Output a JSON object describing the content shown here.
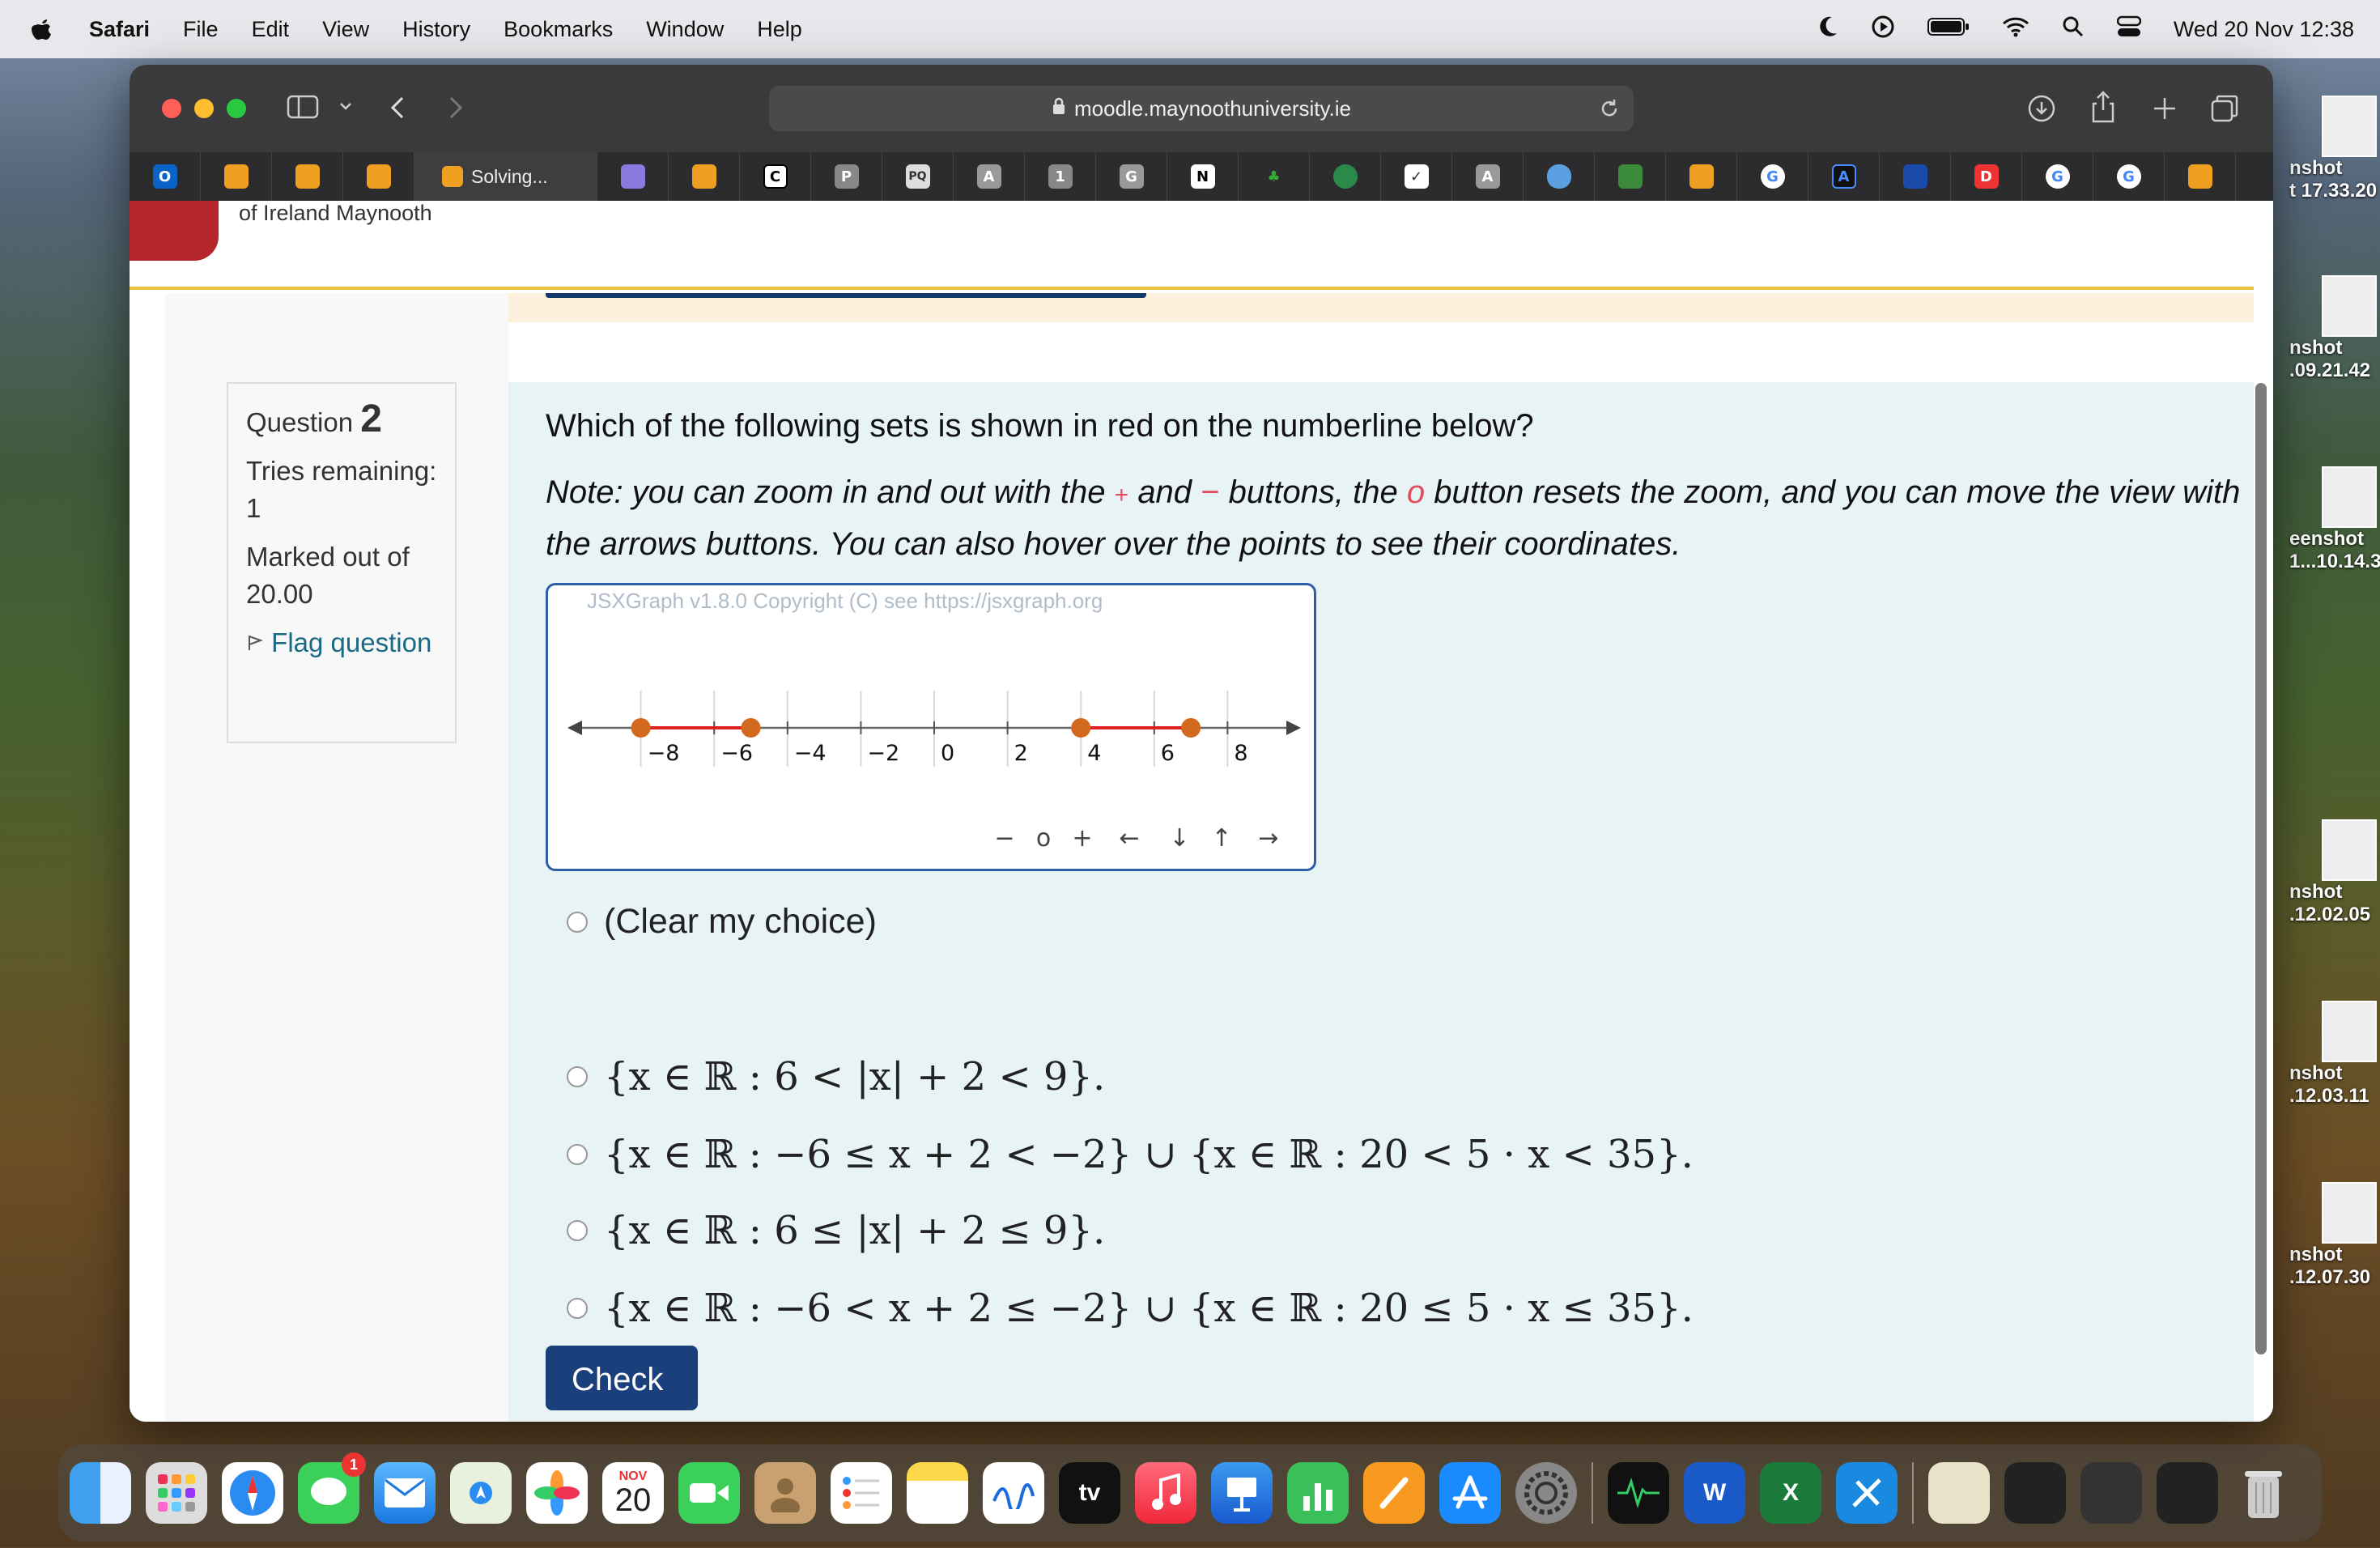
{
  "menubar": {
    "app": "Safari",
    "items": [
      "File",
      "Edit",
      "View",
      "History",
      "Bookmarks",
      "Window",
      "Help"
    ],
    "clock": "Wed 20 Nov  12:38"
  },
  "browser": {
    "url": "moodle.maynoothuniversity.ie",
    "active_tab": "Solving...",
    "tab_badges": [
      "O",
      "",
      "",
      "",
      "",
      "",
      "",
      "C",
      "P",
      "PQ",
      "A",
      "1",
      "G",
      "N",
      "",
      "",
      "",
      "",
      "A",
      "",
      "",
      "",
      "G",
      "A",
      "",
      "D",
      "G",
      "G",
      ""
    ]
  },
  "site": {
    "logo_text": "of Ireland Maynooth"
  },
  "question_info": {
    "label": "Question",
    "number": "2",
    "tries": "Tries remaining: 1",
    "marked": "Marked out of 20.00",
    "flag": "Flag question"
  },
  "question": {
    "text": "Which of the following sets is shown in red on the numberline below?",
    "note_a": "Note: you can zoom in and out with the",
    "plus": "+",
    "note_b": "and",
    "minus": "−",
    "note_c": "buttons, the",
    "reset": "o",
    "note_d": "button resets the zoom, and you can move the view with the arrows buttons. You can also hover over the points to see their coordinates."
  },
  "graph": {
    "copyright": "JSXGraph v1.8.0 Copyright (C) see https://jsxgraph.org",
    "ticks": [
      "−8",
      "−6",
      "−4",
      "−2",
      "0",
      "2",
      "4",
      "6",
      "8"
    ],
    "controls": [
      "−",
      "o",
      "+",
      "←",
      "↓",
      "↑",
      "→"
    ]
  },
  "chart_data": {
    "type": "line",
    "xlim": [
      -10,
      10
    ],
    "ticks": [
      -8,
      -6,
      -4,
      -2,
      0,
      2,
      4,
      6,
      8
    ],
    "series": [
      {
        "x": [
          -8,
          -5
        ],
        "y": [
          0,
          0
        ]
      },
      {
        "x": [
          4,
          7
        ],
        "y": [
          0,
          0
        ]
      }
    ],
    "points": [
      -8,
      -5,
      4,
      7
    ],
    "colors": {
      "segment": "#e02020",
      "point": "#d2691e"
    }
  },
  "options": {
    "clear": "(Clear my choice)",
    "choices": [
      "{x ∈ ℝ : 6 < |x| + 2 < 9}.",
      "{x ∈ ℝ : −6 ≤ x + 2 < −2} ∪ {x ∈ ℝ : 20 < 5 · x < 35}.",
      "{x ∈ ℝ : 6 ≤ |x| + 2 ≤ 9}.",
      "{x ∈ ℝ : −6 < x + 2 ≤ −2} ∪ {x ∈ ℝ : 20 ≤ 5 · x ≤ 35}."
    ]
  },
  "check_label": "Check",
  "desktop_thumbs": [
    {
      "line1": "nshot",
      "line2": "t 17.33.20"
    },
    {
      "line1": "nshot",
      "line2": ".09.21.42"
    },
    {
      "line1": "eenshot",
      "line2": "1...10.14.31"
    },
    {
      "line1": "nshot",
      "line2": ".12.02.05"
    },
    {
      "line1": "nshot",
      "line2": ".12.03.11"
    },
    {
      "line1": "nshot",
      "line2": ".12.07.30"
    }
  ],
  "dock": {
    "calendar_month": "NOV",
    "calendar_day": "20",
    "messages_badge": "1",
    "tv_label": "tv"
  }
}
